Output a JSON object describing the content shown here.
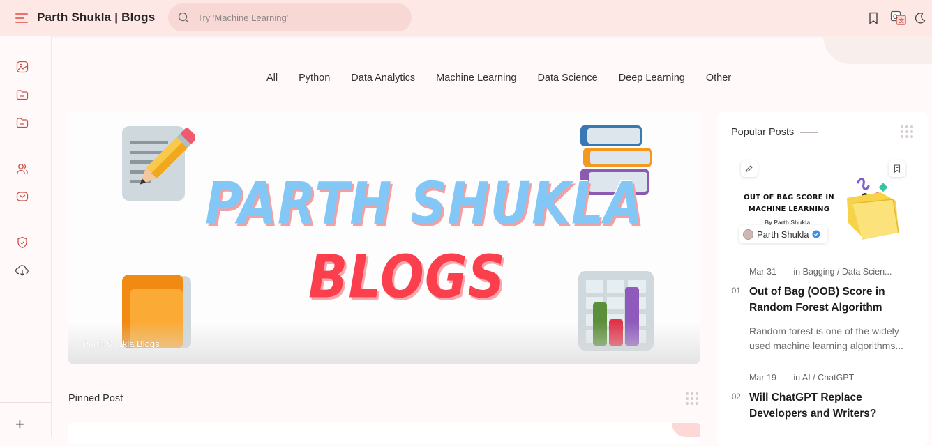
{
  "header": {
    "site_title": "Parth Shukla | Blogs",
    "search_placeholder": "Try 'Machine Learning'",
    "icons": [
      "menu-icon",
      "search-icon",
      "bookmark-icon",
      "translate-icon",
      "moon-icon"
    ]
  },
  "sidebar": {
    "icons": [
      "image-icon",
      "folder-icon",
      "folder-icon",
      "users-icon",
      "mail-icon",
      "shield-icon",
      "download-icon",
      "plus-icon"
    ]
  },
  "categories": [
    "All",
    "Python",
    "Data Analytics",
    "Machine Learning",
    "Data Science",
    "Deep Learning",
    "Other"
  ],
  "hero": {
    "title_line1": "PARTH SHUKLA",
    "title_line2": "BLOGS",
    "caption": "Parth Shukla Blogs",
    "colors": {
      "line1": "#82c7f6",
      "line2": "#fb3f4c"
    }
  },
  "pinned": {
    "label": "Pinned Post"
  },
  "popular": {
    "label": "Popular Posts",
    "thumbnail": {
      "title": "OUT OF BAG SCORE IN MACHINE LEARNING",
      "byline": "By Parth Shukla",
      "author": "Parth Shukla"
    },
    "posts": [
      {
        "num": "01",
        "date": "Mar 31",
        "category": "in Bagging / Data Scien...",
        "title": "Out of Bag (OOB) Score in Random Forest Algorithm",
        "excerpt": "Random forest is one of the widely used machine learning algorithms..."
      },
      {
        "num": "02",
        "date": "Mar 19",
        "category": "in AI / ChatGPT",
        "title": "Will ChatGPT Replace Developers and Writers?",
        "excerpt": ""
      }
    ]
  }
}
